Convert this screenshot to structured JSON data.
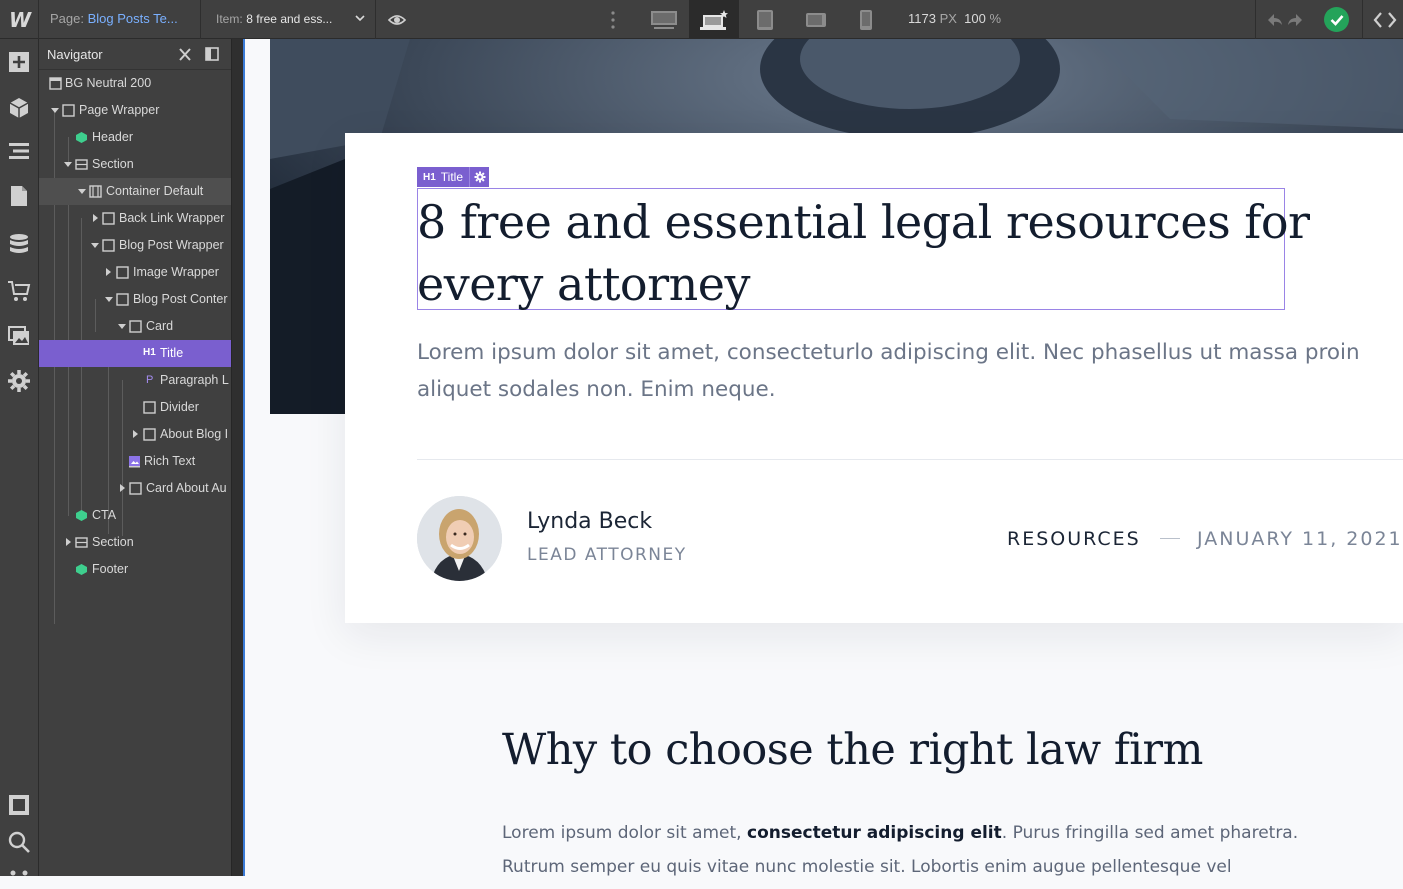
{
  "topbar": {
    "logo": "W",
    "page_label": "Page:",
    "page_value": "Blog Posts Te...",
    "item_label": "Item:",
    "item_value": "8 free and ess...",
    "width_value": "1173",
    "width_unit": "PX",
    "zoom_value": "100",
    "zoom_unit": "%",
    "icons": [
      "chevron-down-icon",
      "eye-icon",
      "more-vertical-icon",
      "desktop-icon",
      "laptop-star-icon",
      "tablet-icon",
      "tablet-landscape-icon",
      "mobile-icon",
      "undo-icon",
      "redo-icon",
      "check-icon",
      "code-icon"
    ],
    "publish_status_color": "#24a35a"
  },
  "left_toolbar": {
    "icons": [
      "add-icon",
      "box-icon",
      "navigator-icon",
      "pages-icon",
      "cms-icon",
      "ecommerce-icon",
      "assets-icon",
      "settings-icon",
      "preview-frame-icon",
      "search-icon",
      "more-icon"
    ]
  },
  "navigator": {
    "title": "Navigator",
    "items": [
      {
        "label": "BG Neutral 200",
        "icon": "body-icon"
      },
      {
        "label": "Page Wrapper",
        "icon": "div-icon"
      },
      {
        "label": "Header",
        "icon": "symbol-icon"
      },
      {
        "label": "Section",
        "icon": "section-icon"
      },
      {
        "label": "Container Default",
        "icon": "container-icon"
      },
      {
        "label": "Back Link Wrapper",
        "icon": "div-icon"
      },
      {
        "label": "Blog Post Wrapper",
        "icon": "div-icon"
      },
      {
        "label": "Image Wrapper",
        "icon": "div-icon"
      },
      {
        "label": "Blog Post Conter",
        "icon": "div-icon"
      },
      {
        "label": "Card",
        "icon": "div-icon"
      },
      {
        "label": "Title",
        "icon": "h1-icon"
      },
      {
        "label": "Paragraph L",
        "icon": "paragraph-icon"
      },
      {
        "label": "Divider",
        "icon": "div-icon"
      },
      {
        "label": "About Blog I",
        "icon": "div-icon"
      },
      {
        "label": "Rich Text",
        "icon": "rich-text-icon"
      },
      {
        "label": "Card About Au",
        "icon": "div-icon"
      },
      {
        "label": "CTA",
        "icon": "symbol-icon"
      },
      {
        "label": "Section",
        "icon": "section-icon"
      },
      {
        "label": "Footer",
        "icon": "symbol-icon"
      }
    ],
    "selected_color": "#7a5fcf",
    "symbol_color": "#3ecf8e"
  },
  "canvas": {
    "selection_tag": {
      "tag": "H1",
      "label": "Title"
    },
    "title": "8 free and essential legal resources for every attorney",
    "lead": "Lorem ipsum dolor sit amet, consecteturlo adipiscing elit. Nec phasellus ut massa proin aliquet sodales non. Enim neque.",
    "author_name": "Lynda Beck",
    "author_role": "LEAD ATTORNEY",
    "category": "RESOURCES",
    "date": "JANUARY 11, 2021",
    "section_heading": "Why to choose the right law firm",
    "body_start": "Lorem ipsum dolor sit amet, ",
    "body_bold": "consectetur adipiscing elit",
    "body_end": ". Purus fringilla sed amet pharetra. Rutrum semper eu quis vitae nunc molestie sit. Lobortis enim augue pellentesque vel"
  }
}
